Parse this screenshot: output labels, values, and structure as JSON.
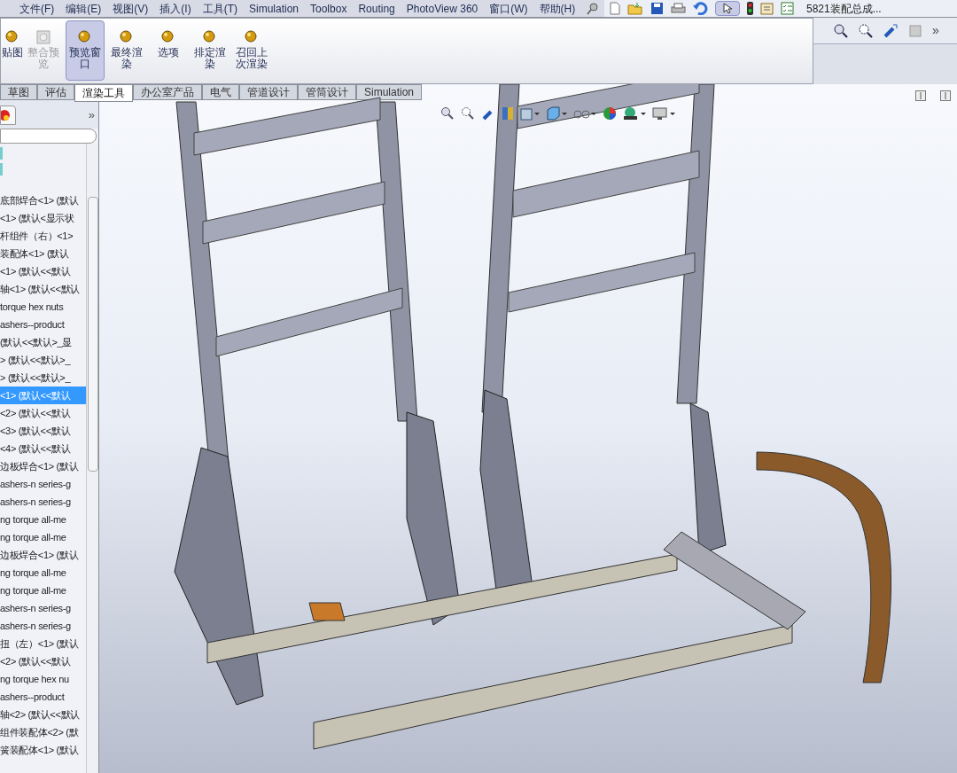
{
  "menu": [
    "文件(F)",
    "编辑(E)",
    "视图(V)",
    "插入(I)",
    "工具(T)",
    "Simulation",
    "Toolbox",
    "Routing",
    "PhotoView 360",
    "窗口(W)",
    "帮助(H)"
  ],
  "document_title": "5821装配总成...",
  "toolbar_overflow": "»",
  "panel_expand": "»",
  "ribbon_buttons": [
    {
      "label": "贴图",
      "disabled": false,
      "selected": false
    },
    {
      "label": "整合预览",
      "disabled": true,
      "selected": false
    },
    {
      "label": "预览窗口",
      "disabled": false,
      "selected": true
    },
    {
      "label": "最终渲染",
      "disabled": false,
      "selected": false
    },
    {
      "label": "选项",
      "disabled": false,
      "selected": false
    },
    {
      "label": "排定渲染",
      "disabled": false,
      "selected": false
    },
    {
      "label": "召回上次渲染",
      "disabled": false,
      "selected": false
    }
  ],
  "tabs": [
    {
      "label": "草图",
      "selected": false
    },
    {
      "label": "评估",
      "selected": false
    },
    {
      "label": "渲染工具",
      "selected": true
    },
    {
      "label": "办公室产品",
      "selected": false
    },
    {
      "label": "电气",
      "selected": false
    },
    {
      "label": "管道设计",
      "selected": false
    },
    {
      "label": "管筒设计",
      "selected": false
    },
    {
      "label": "Simulation",
      "selected": false
    }
  ],
  "tree": [
    {
      "label": "底部焊合<1> (默认",
      "selected": false
    },
    {
      "label": "<1> (默认<显示状",
      "selected": false
    },
    {
      "label": "杆组件（右）<1>",
      "selected": false
    },
    {
      "label": "装配体<1> (默认",
      "selected": false
    },
    {
      "label": "<1> (默认<<默认",
      "selected": false
    },
    {
      "label": "轴<1> (默认<<默认",
      "selected": false
    },
    {
      "label": "torque hex nuts",
      "selected": false
    },
    {
      "label": "ashers--product",
      "selected": false
    },
    {
      "label": "(默认<<默认>_显",
      "selected": false
    },
    {
      "label": "> (默认<<默认>_",
      "selected": false
    },
    {
      "label": "> (默认<<默认>_",
      "selected": false
    },
    {
      "label": "<1> (默认<<默认",
      "selected": true
    },
    {
      "label": "<2> (默认<<默认",
      "selected": false
    },
    {
      "label": "<3> (默认<<默认",
      "selected": false
    },
    {
      "label": "<4> (默认<<默认",
      "selected": false
    },
    {
      "label": "边板焊合<1> (默认",
      "selected": false
    },
    {
      "label": "ashers-n series-g",
      "selected": false
    },
    {
      "label": "ashers-n series-g",
      "selected": false
    },
    {
      "label": "ng torque all-me",
      "selected": false
    },
    {
      "label": "ng torque all-me",
      "selected": false
    },
    {
      "label": "边板焊合<1> (默认",
      "selected": false
    },
    {
      "label": "ng torque all-me",
      "selected": false
    },
    {
      "label": "ng torque all-me",
      "selected": false
    },
    {
      "label": "ashers-n series-g",
      "selected": false
    },
    {
      "label": "ashers-n series-g",
      "selected": false
    },
    {
      "label": "扭（左）<1> (默认",
      "selected": false
    },
    {
      "label": "<2> (默认<<默认",
      "selected": false
    },
    {
      "label": "ng torque hex nu",
      "selected": false
    },
    {
      "label": "ashers--product",
      "selected": false
    },
    {
      "label": "轴<2> (默认<<默认",
      "selected": false
    },
    {
      "label": "组件装配体<2> (默",
      "selected": false
    },
    {
      "label": "簧装配体<1> (默认",
      "selected": false
    }
  ]
}
